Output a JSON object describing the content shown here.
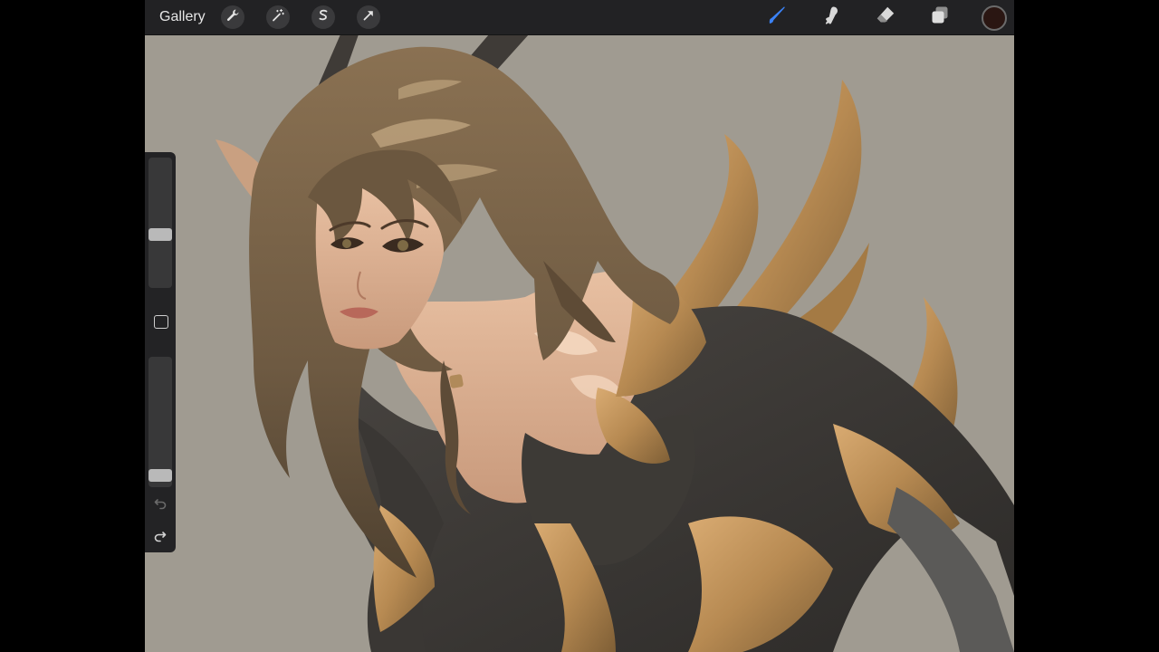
{
  "toolbar": {
    "gallery_label": "Gallery",
    "left_tools": [
      "wrench-icon",
      "magic-wand-icon",
      "selection-icon",
      "transform-arrow-icon"
    ],
    "right_tools": [
      "brush-icon",
      "smudge-icon",
      "eraser-icon",
      "layers-icon"
    ],
    "active_tool": "brush",
    "active_tool_color": "#3b82f6",
    "current_color": "#2a1612"
  },
  "sidebar": {
    "brush_size_level": 0.4,
    "opacity_level": 0.05,
    "undo_enabled": false,
    "redo_enabled": true
  },
  "canvas": {
    "background_color": "#a09b91"
  }
}
